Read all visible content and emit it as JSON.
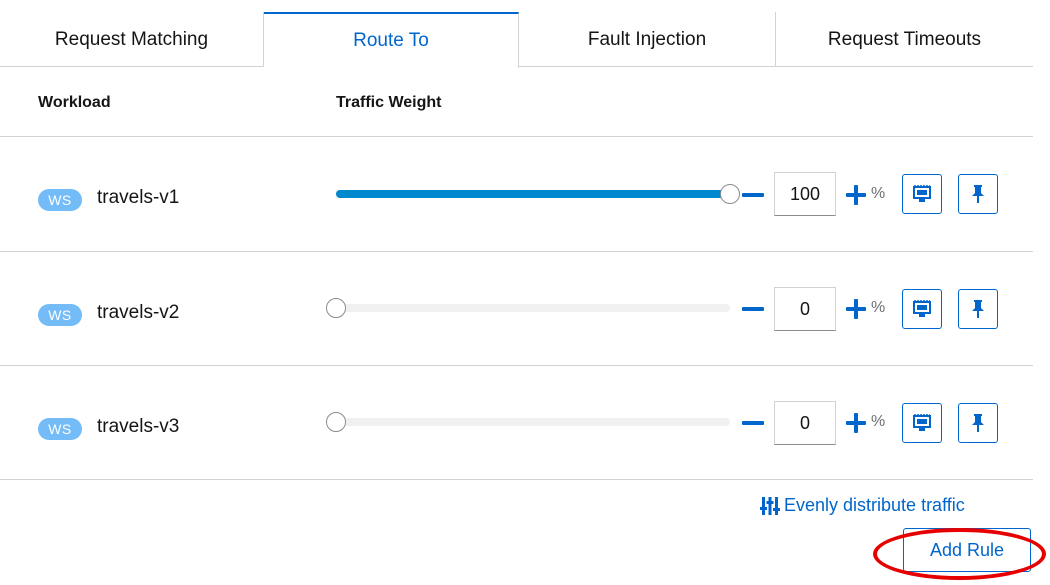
{
  "tabs": [
    {
      "label": "Request Matching"
    },
    {
      "label": "Route To",
      "active": true
    },
    {
      "label": "Fault Injection"
    },
    {
      "label": "Request Timeouts"
    }
  ],
  "columns": {
    "workload": "Workload",
    "traffic_weight": "Traffic Weight"
  },
  "rows": [
    {
      "badge": "WS",
      "name": "travels-v1",
      "weight": "100",
      "weight_fraction": 1.0
    },
    {
      "badge": "WS",
      "name": "travels-v2",
      "weight": "0",
      "weight_fraction": 0.0
    },
    {
      "badge": "WS",
      "name": "travels-v3",
      "weight": "0",
      "weight_fraction": 0.0
    }
  ],
  "percent_symbol": "%",
  "footer": {
    "evenly_distribute": "Evenly distribute traffic",
    "add_rule": "Add Rule",
    "bottom_text": "... ., . ."
  },
  "icons": {
    "mirror": "mirror-icon",
    "pin": "pin-icon",
    "distribute": "distribute-icon"
  },
  "colors": {
    "accent": "#0066cc",
    "slider_fill": "#0088ce",
    "badge": "#73bcf7",
    "annotation": "#e60000"
  }
}
